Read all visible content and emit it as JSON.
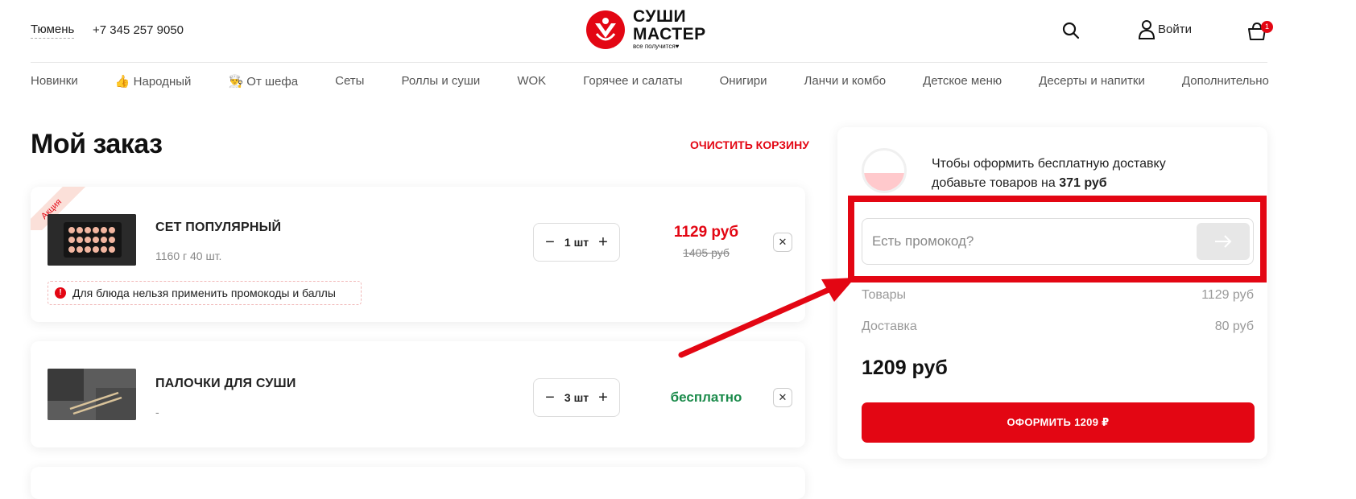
{
  "header": {
    "city": "Тюмень",
    "phone": "+7 345 257 9050",
    "logo_title_line1": "СУШИ",
    "logo_title_line2": "МАСТЕР",
    "logo_tagline": "все получится♥",
    "login_label": "Войти",
    "cart_count": "1"
  },
  "nav": {
    "items": [
      "Новинки",
      "👍 Народный",
      "👨‍🍳 От шефа",
      "Сеты",
      "Роллы и суши",
      "WOK",
      "Горячее и салаты",
      "Онигири",
      "Ланчи и комбо",
      "Детское меню",
      "Десерты и напитки",
      "Дополнительно"
    ]
  },
  "order": {
    "title": "Мой заказ",
    "clear_label": "ОЧИСТИТЬ КОРЗИНУ",
    "items": [
      {
        "badge": "Акция",
        "name": "СЕТ ПОПУЛЯРНЫЙ",
        "meta": "1160 г 40 шт.",
        "qty": "1 шт",
        "price": "1129 руб",
        "old_price": "1405 руб",
        "notice": "Для блюда нельзя применить промокоды и баллы"
      },
      {
        "name": "ПАЛОЧКИ ДЛЯ СУШИ",
        "meta": "-",
        "qty": "3 шт",
        "price": "бесплатно"
      }
    ]
  },
  "summary": {
    "delivery_line1": "Чтобы оформить бесплатную доставку",
    "delivery_line2_prefix": "добавьте товаров на ",
    "delivery_amount": "371 руб",
    "delivery_progress": 0.45,
    "promo_placeholder": "Есть промокод?",
    "goods_label": "Товары",
    "goods_value": "1129 руб",
    "delivery_label": "Доставка",
    "delivery_value": "80 руб",
    "total": "1209 руб",
    "checkout_label": "ОФОРМИТЬ 1209 ₽"
  },
  "colors": {
    "brand_red": "#e30613",
    "free_green": "#1a8a4a",
    "annotation_red": "#e30613"
  }
}
